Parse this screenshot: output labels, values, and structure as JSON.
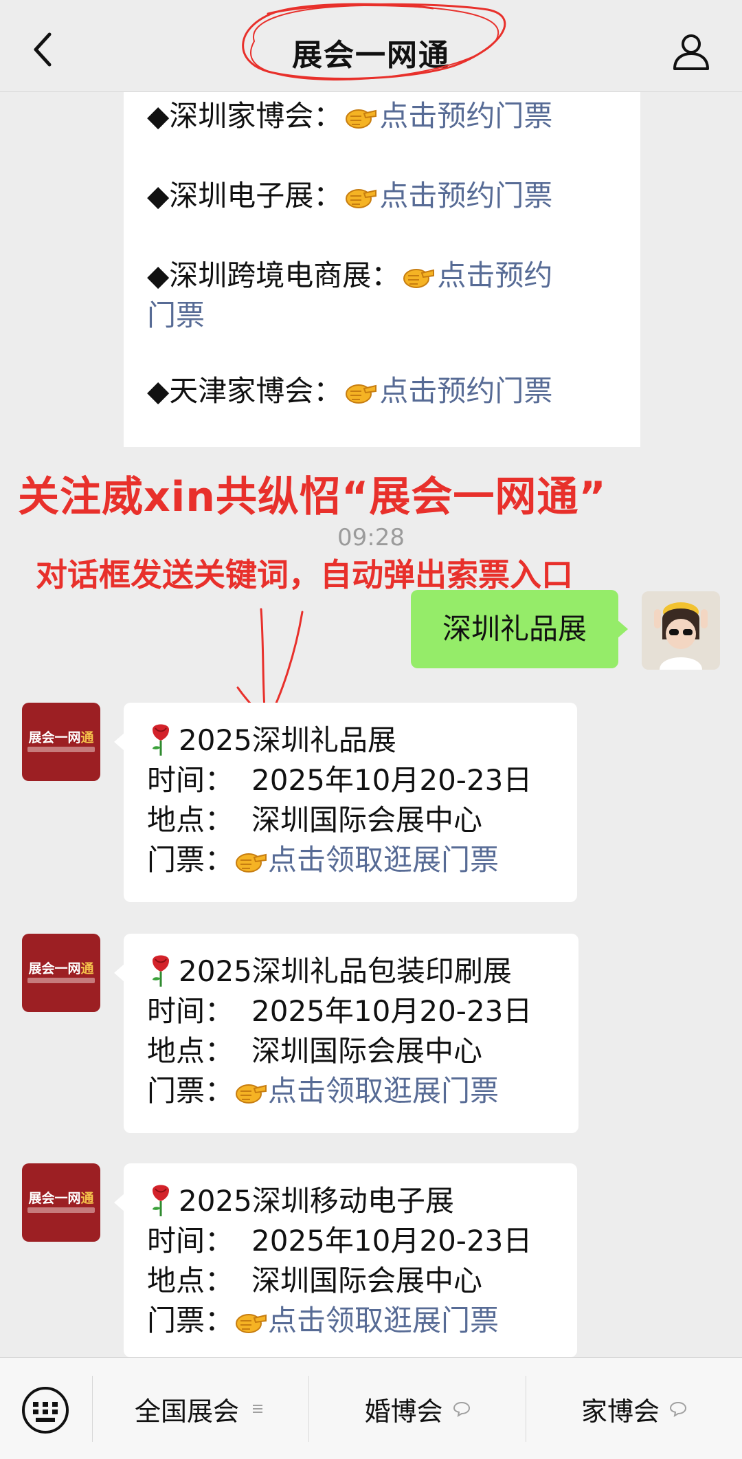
{
  "header": {
    "title": "展会一网通"
  },
  "prev_card": {
    "items": [
      {
        "label": "◆深圳家博会：",
        "link": "点击预约门票"
      },
      {
        "label": "◆深圳电子展：",
        "link": "点击预约门票"
      },
      {
        "label": "◆深圳跨境电商展：",
        "link": "点击预约门票"
      },
      {
        "label": "◆天津家博会：",
        "link": "点击预约门票"
      }
    ],
    "wrap_parts": [
      "点击预约",
      "门票"
    ]
  },
  "overlay": {
    "promo_line1": "关注威xin共纵怊“展会一网通”",
    "promo_line2": "对话框发送关键词，自动弹出索票入口"
  },
  "chat": {
    "timestamp": "09:28",
    "my_message": "深圳礼品展",
    "oa_brand": {
      "main": "展会一网",
      "accent": "通"
    },
    "replies": [
      {
        "title": "2025深圳礼品展",
        "time_label": "时间：",
        "time_value": "2025年10月20-23日",
        "place_label": "地点：",
        "place_value": "深圳国际会展中心",
        "ticket_label": "门票：",
        "ticket_link": "点击领取逛展门票"
      },
      {
        "title": "2025深圳礼品包装印刷展",
        "time_label": "时间：",
        "time_value": "2025年10月20-23日",
        "place_label": "地点：",
        "place_value": "深圳国际会展中心",
        "ticket_label": "门票：",
        "ticket_link": "点击领取逛展门票"
      },
      {
        "title": "2025深圳移动电子展",
        "time_label": "时间：",
        "time_value": "2025年10月20-23日",
        "place_label": "地点：",
        "place_value": "深圳国际会展中心",
        "ticket_label": "门票：",
        "ticket_link": "点击领取逛展门票"
      }
    ]
  },
  "bottom_menu": {
    "items": [
      "全国展会",
      "婚博会",
      "家博会"
    ]
  },
  "colors": {
    "link": "#576b95",
    "promo_red": "#e8302b",
    "my_bubble": "#95ec69",
    "oa_avatar_bg": "#9c1f23",
    "page_bg": "#ededed"
  }
}
